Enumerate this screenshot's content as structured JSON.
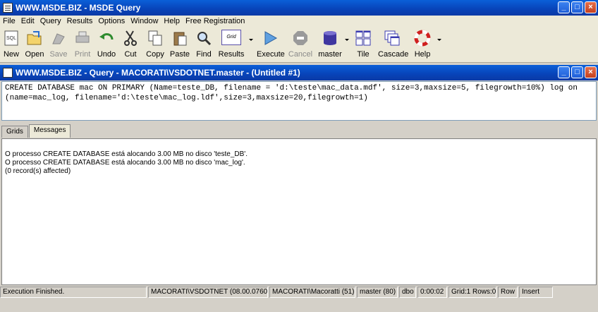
{
  "app": {
    "title": "WWW.MSDE.BIZ - MSDE Query"
  },
  "menu": [
    "File",
    "Edit",
    "Query",
    "Results",
    "Options",
    "Window",
    "Help",
    "Free Registration"
  ],
  "toolbar": {
    "new": "New",
    "open": "Open",
    "save": "Save",
    "print": "Print",
    "undo": "Undo",
    "cut": "Cut",
    "copy": "Copy",
    "paste": "Paste",
    "find": "Find",
    "results": "Results",
    "results_grid": "Grid",
    "execute": "Execute",
    "cancel": "Cancel",
    "database": "master",
    "tile": "Tile",
    "cascade": "Cascade",
    "help": "Help"
  },
  "query_window": {
    "title": "WWW.MSDE.BIZ - Query - MACORATI\\VSDOTNET.master - (Untitled #1)",
    "sql_line1": "CREATE DATABASE mac ON PRIMARY (Name=teste_DB, filename = 'd:\\teste\\mac_data.mdf', size=3,maxsize=5, filegrowth=10%) log on",
    "sql_line2": "(name=mac_log, filename='d:\\teste\\mac_log.ldf',size=3,maxsize=20,filegrowth=1)"
  },
  "tabs": [
    "Grids",
    "Messages"
  ],
  "messages": [
    "O processo CREATE DATABASE está alocando 3.00 MB no disco 'teste_DB'.",
    "O processo CREATE DATABASE está alocando 3.00 MB no disco 'mac_log'.",
    "(0 record(s) affected)"
  ],
  "status": {
    "message": "Execution Finished.",
    "server": "MACORATI\\VSDOTNET (08.00.0760)",
    "user": "MACORATI\\Macoratti (51)",
    "database": "master (80)",
    "owner": "dbo",
    "elapsed": "0:00:02",
    "grid_rows": "Grid:1 Rows:0",
    "row": "Row",
    "mode": "Insert"
  },
  "colors": {
    "titlebar": "#0a5fd8",
    "window_bg": "#d4d0c8",
    "toolbar_bg": "#ece9d8"
  }
}
